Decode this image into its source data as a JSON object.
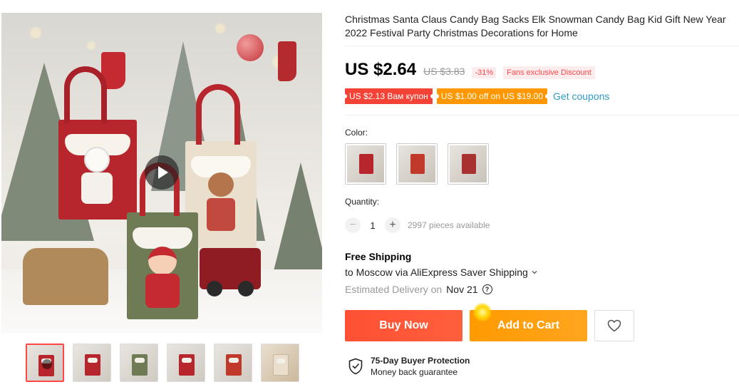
{
  "product": {
    "title": "Christmas Santa Claus Candy Bag Sacks Elk Snowman Candy Bag Kid Gift New Year 2022 Festival Party Christmas Decorations for Home"
  },
  "price": {
    "current": "US $2.64",
    "original": "US $3.83",
    "discount": "-31%",
    "fans_badge": "Fans exclusive Discount"
  },
  "coupons": {
    "items": [
      "US $2.13 Вам купон",
      "US $1.00 off on US $19.00"
    ],
    "get_label": "Get coupons"
  },
  "color": {
    "label": "Color:",
    "options": [
      "snowman",
      "santa",
      "elk"
    ]
  },
  "quantity": {
    "label": "Quantity:",
    "value": "1",
    "minus": "−",
    "plus": "+",
    "available": "2997 pieces available"
  },
  "shipping": {
    "title": "Free Shipping",
    "to": "to Moscow via AliExpress Saver Shipping",
    "delivery_label": "Estimated Delivery on",
    "delivery_date": "Nov 21",
    "help": "?"
  },
  "actions": {
    "buy_now": "Buy Now",
    "add_to_cart": "Add to Cart",
    "wishlist_icon": "heart-icon"
  },
  "protection": {
    "title": "75-Day Buyer Protection",
    "subtitle": "Money back guarantee"
  },
  "gallery": {
    "thumb_count": 6,
    "active_index": 0
  },
  "colors": {
    "accent_red": "#ff4747",
    "buy_now": "#ff5033",
    "add_to_cart": "#ff9a00",
    "link": "#2e9cc3"
  }
}
